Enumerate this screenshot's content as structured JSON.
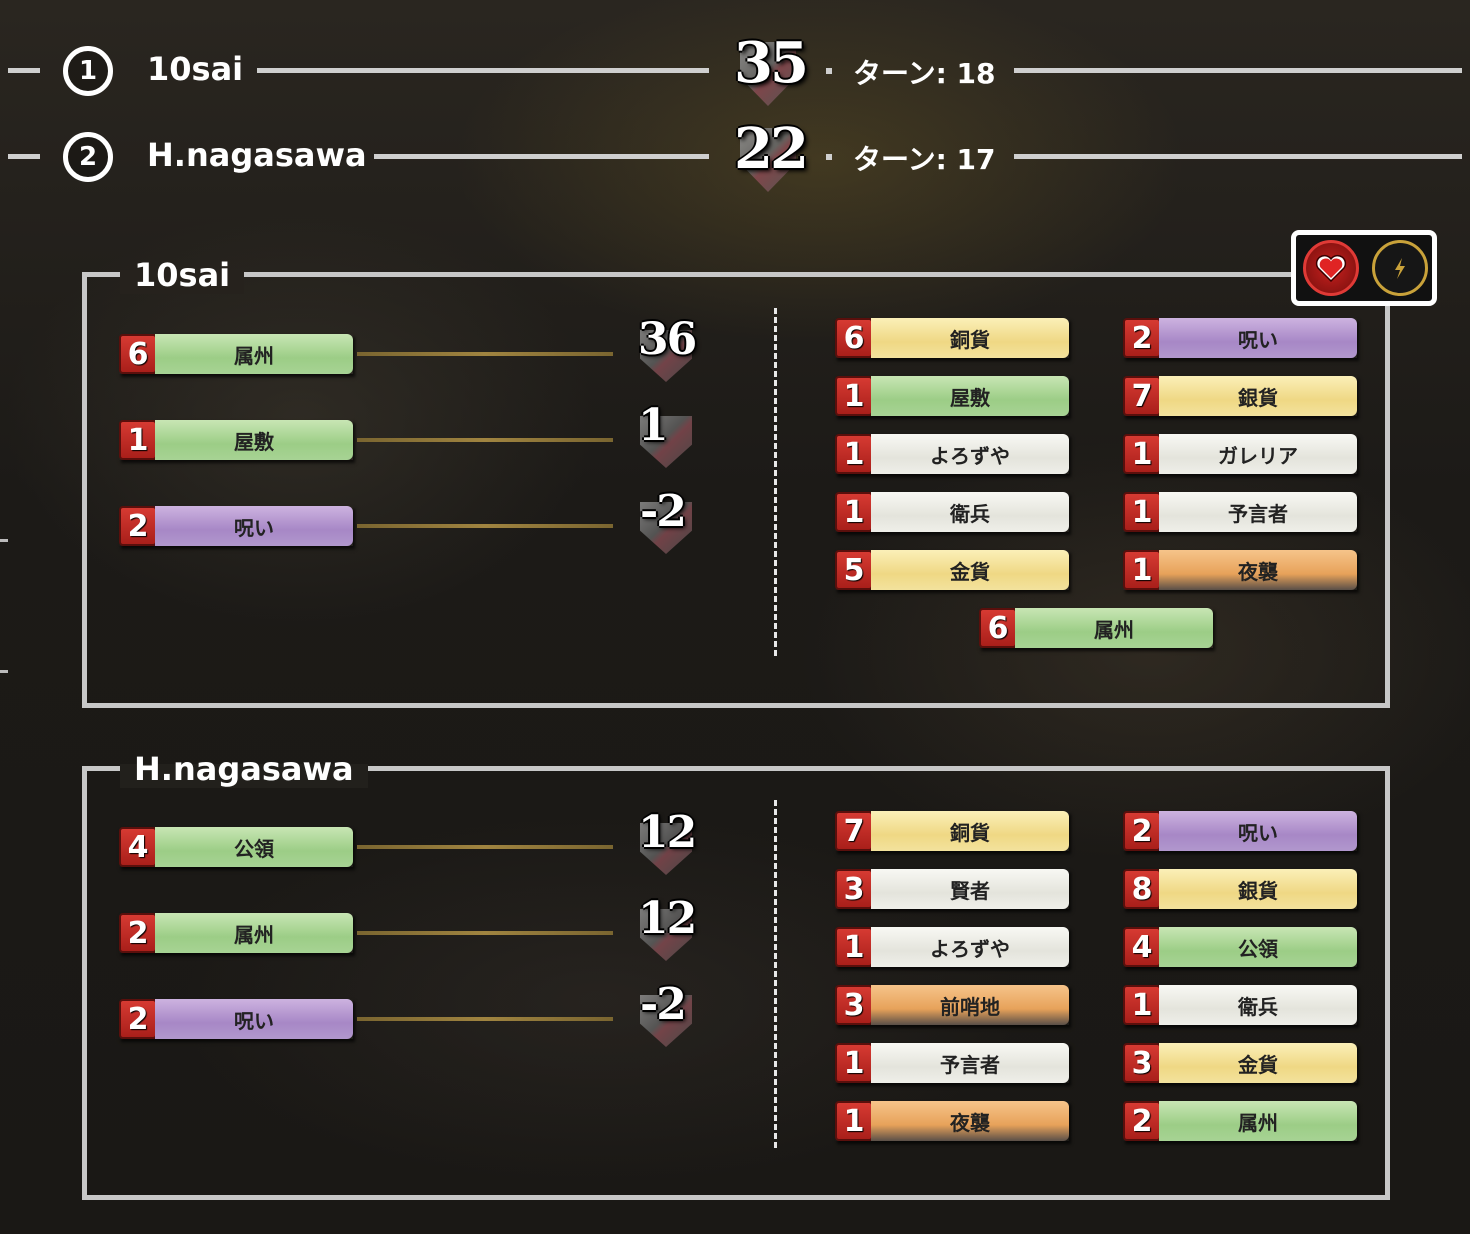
{
  "players": [
    {
      "rank": "1",
      "name": "10sai",
      "score": "35",
      "turn_label": "ターン: 18"
    },
    {
      "rank": "2",
      "name": "H.nagasawa",
      "score": "22",
      "turn_label": "ターン: 17"
    }
  ],
  "panels": [
    {
      "title": "10sai",
      "scoring": [
        {
          "count": "6",
          "label": "属州",
          "color": "green",
          "points": "36"
        },
        {
          "count": "1",
          "label": "屋敷",
          "color": "green",
          "points": "1"
        },
        {
          "count": "2",
          "label": "呪い",
          "color": "purple",
          "points": "-2"
        }
      ],
      "deck": [
        {
          "count": "6",
          "label": "銅貨",
          "color": "yellow"
        },
        {
          "count": "2",
          "label": "呪い",
          "color": "purple"
        },
        {
          "count": "1",
          "label": "屋敷",
          "color": "green"
        },
        {
          "count": "7",
          "label": "銀貨",
          "color": "yellow"
        },
        {
          "count": "1",
          "label": "よろずや",
          "color": "white"
        },
        {
          "count": "1",
          "label": "ガレリア",
          "color": "white"
        },
        {
          "count": "1",
          "label": "衛兵",
          "color": "white"
        },
        {
          "count": "1",
          "label": "予言者",
          "color": "white"
        },
        {
          "count": "5",
          "label": "金貨",
          "color": "yellow"
        },
        {
          "count": "1",
          "label": "夜襲",
          "color": "orange"
        },
        {
          "count": "6",
          "label": "属州",
          "color": "green"
        }
      ]
    },
    {
      "title": "H.nagasawa",
      "scoring": [
        {
          "count": "4",
          "label": "公領",
          "color": "green",
          "points": "12"
        },
        {
          "count": "2",
          "label": "属州",
          "color": "green",
          "points": "12"
        },
        {
          "count": "2",
          "label": "呪い",
          "color": "purple",
          "points": "-2"
        }
      ],
      "deck": [
        {
          "count": "7",
          "label": "銅貨",
          "color": "yellow"
        },
        {
          "count": "2",
          "label": "呪い",
          "color": "purple"
        },
        {
          "count": "3",
          "label": "賢者",
          "color": "white"
        },
        {
          "count": "8",
          "label": "銀貨",
          "color": "yellow"
        },
        {
          "count": "1",
          "label": "よろずや",
          "color": "white"
        },
        {
          "count": "4",
          "label": "公領",
          "color": "green"
        },
        {
          "count": "3",
          "label": "前哨地",
          "color": "orange"
        },
        {
          "count": "1",
          "label": "衛兵",
          "color": "white"
        },
        {
          "count": "1",
          "label": "予言者",
          "color": "white"
        },
        {
          "count": "3",
          "label": "金貨",
          "color": "yellow"
        },
        {
          "count": "1",
          "label": "夜襲",
          "color": "orange"
        },
        {
          "count": "2",
          "label": "属州",
          "color": "green"
        }
      ]
    }
  ],
  "icons": {
    "heart": "heart-icon",
    "bolt": "lightning-icon"
  }
}
